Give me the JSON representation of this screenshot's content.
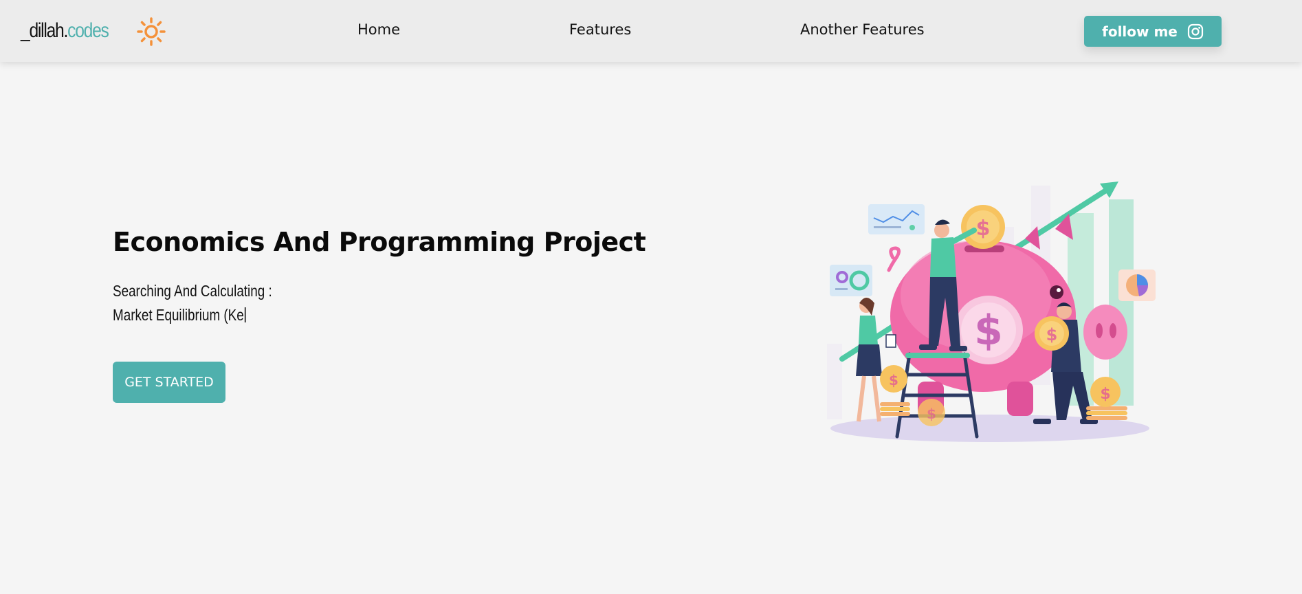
{
  "brand": {
    "name_main": "_dillah.",
    "name_accent": "codes",
    "icon": "sun-icon",
    "accent_color": "#4fb0ad",
    "sun_color": "#f4913a"
  },
  "nav": {
    "links": [
      {
        "label": "Home"
      },
      {
        "label": "Features"
      },
      {
        "label": "Another Features"
      }
    ],
    "follow_button": {
      "label": "follow me",
      "icon": "instagram-icon"
    }
  },
  "hero": {
    "title": "Economics And Programming Project",
    "subtitle_line1": "Searching And Calculating :",
    "typing_text": "Market Equilibrium (Ke",
    "cta_label": "GET STARTED"
  },
  "illustration": {
    "coin_symbol": "$",
    "pig_color": "#f06aa8",
    "accent_green": "#5fcfa8"
  }
}
